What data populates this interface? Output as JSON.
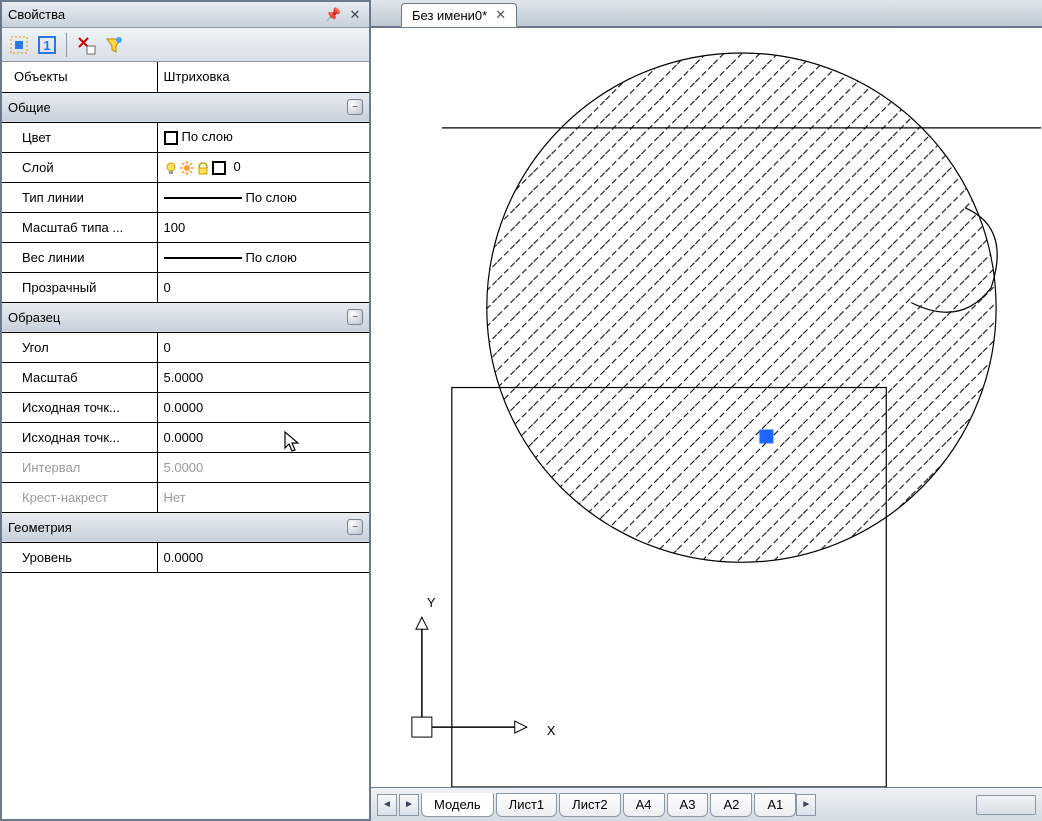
{
  "panel": {
    "title": "Свойства",
    "toolbar_object_label": "Объекты",
    "toolbar_object_value": "Штриховка"
  },
  "groups": {
    "common": "Общие",
    "pattern": "Образец",
    "geometry": "Геометрия"
  },
  "rows": {
    "color": {
      "label": "Цвет",
      "value": "По слою"
    },
    "layer": {
      "label": "Слой",
      "value": "0"
    },
    "linetype": {
      "label": "Тип линии",
      "value": "По слою"
    },
    "ltscale": {
      "label": "Масштаб типа ...",
      "value": "100"
    },
    "lineweight": {
      "label": "Вес линии",
      "value": "По слою"
    },
    "transparent": {
      "label": "Прозрачный",
      "value": "0"
    },
    "angle": {
      "label": "Угол",
      "value": "0"
    },
    "scale": {
      "label": "Масштаб",
      "value": "5.0000"
    },
    "origin_x": {
      "label": "Исходная точк...",
      "value": "0.0000"
    },
    "origin_y": {
      "label": "Исходная точк...",
      "value": "0.0000"
    },
    "spacing": {
      "label": "Интервал",
      "value": "5.0000"
    },
    "double": {
      "label": "Крест-накрест",
      "value": "Нет"
    },
    "level": {
      "label": "Уровень",
      "value": "0.0000"
    }
  },
  "document_tab": "Без имени0*",
  "axis": {
    "x": "X",
    "y": "Y"
  },
  "sheet_tabs": [
    "Модель",
    "Лист1",
    "Лист2",
    "A4",
    "A3",
    "A2",
    "A1"
  ]
}
